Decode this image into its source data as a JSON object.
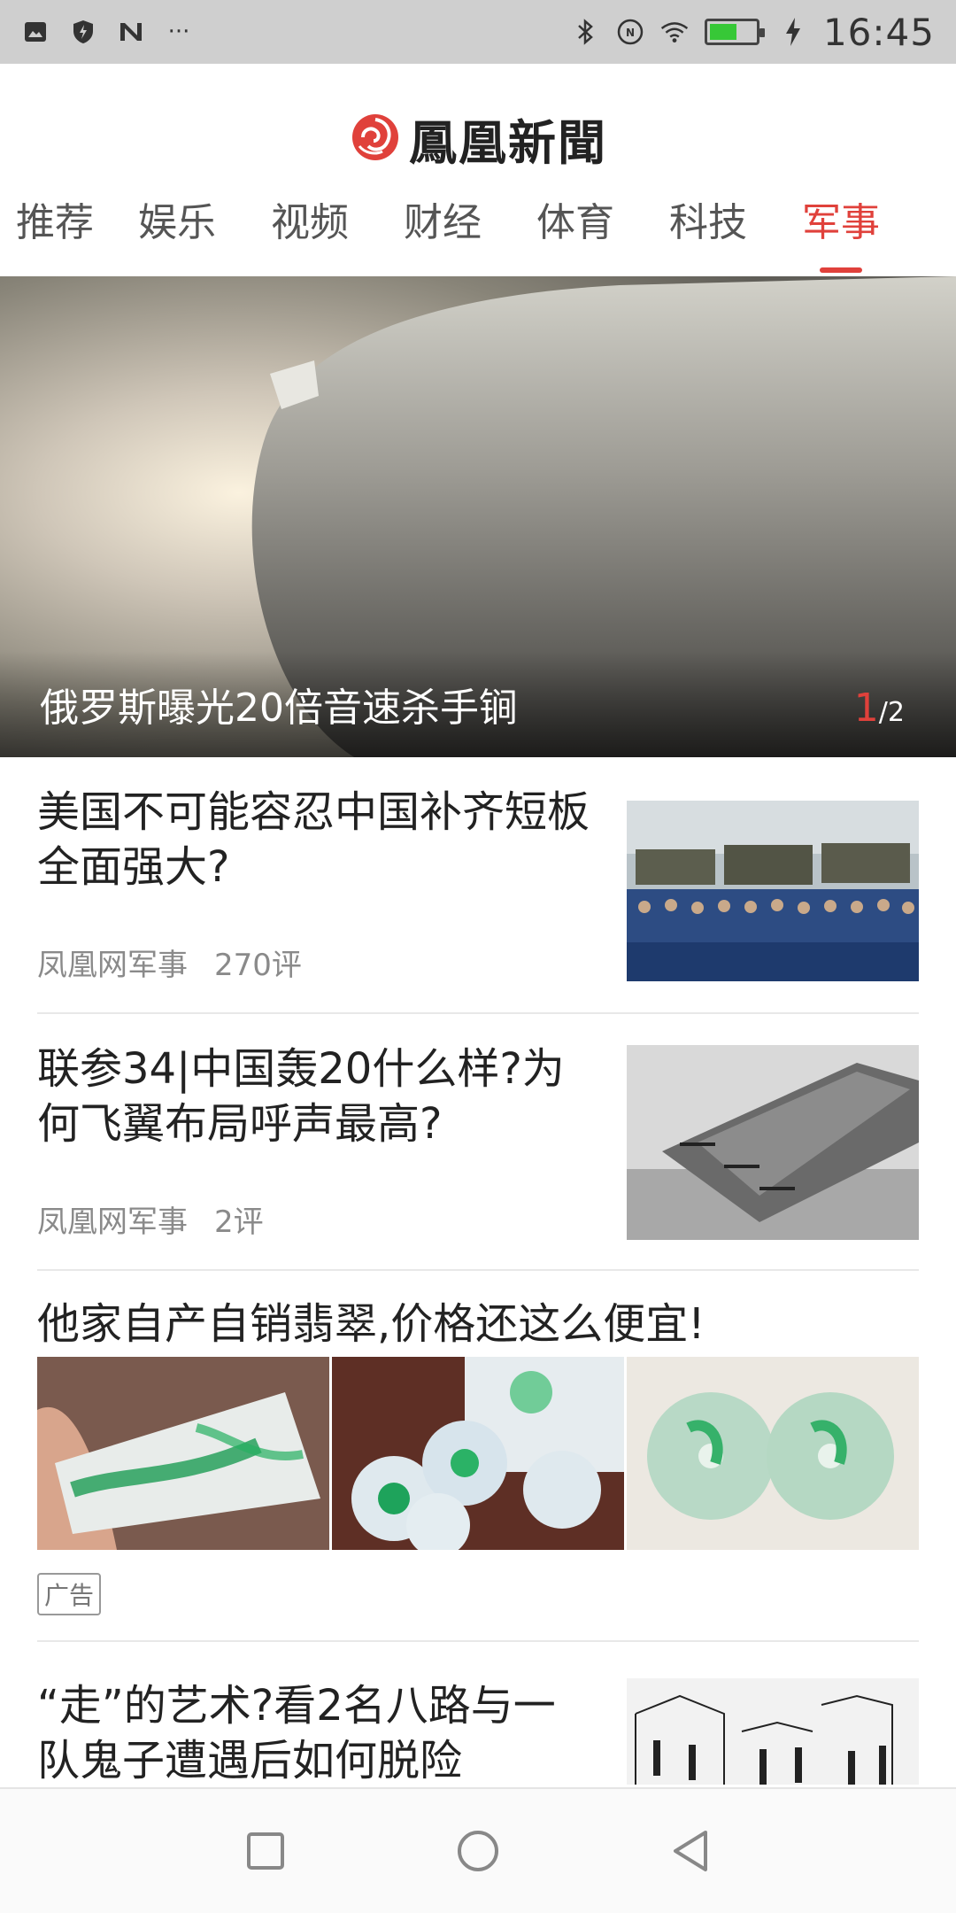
{
  "status_bar": {
    "time": "16:45",
    "left_icons": [
      "image-icon",
      "shield-icon",
      "n-icon",
      "more-dots-icon"
    ],
    "right_icons": [
      "bluetooth-icon",
      "nfc-icon",
      "wifi-icon",
      "battery-icon",
      "charging-icon"
    ],
    "overflow_label": "···"
  },
  "header": {
    "logo_text": "鳳凰新聞",
    "tabs": [
      {
        "label": "推荐",
        "active": false
      },
      {
        "label": "娱乐",
        "active": false
      },
      {
        "label": "视频",
        "active": false
      },
      {
        "label": "财经",
        "active": false
      },
      {
        "label": "体育",
        "active": false
      },
      {
        "label": "科技",
        "active": false
      },
      {
        "label": "军事",
        "active": true
      }
    ],
    "accent_color": "#e0413b"
  },
  "hero": {
    "caption": "俄罗斯曝光20倍音速杀手锏",
    "counter_current": "1",
    "counter_total": "/2"
  },
  "articles": [
    {
      "title": "美国不可能容忍中国补齐短板全面强大?",
      "source": "凤凰网军事",
      "comments": "270评"
    },
    {
      "title": "联参34|中国轰20什么样?为何飞翼布局呼声最高?",
      "source": "凤凰网军事",
      "comments": "2评"
    },
    {
      "title": "“走”的艺术?看2名八路与一队鬼子遭遇后如何脱险",
      "source": "",
      "comments": ""
    }
  ],
  "ad": {
    "title": "他家自产自销翡翠,价格还这么便宜!",
    "badge": "广告"
  },
  "nav_bar": {
    "buttons": [
      "recents-square-icon",
      "home-circle-icon",
      "back-triangle-icon"
    ]
  }
}
